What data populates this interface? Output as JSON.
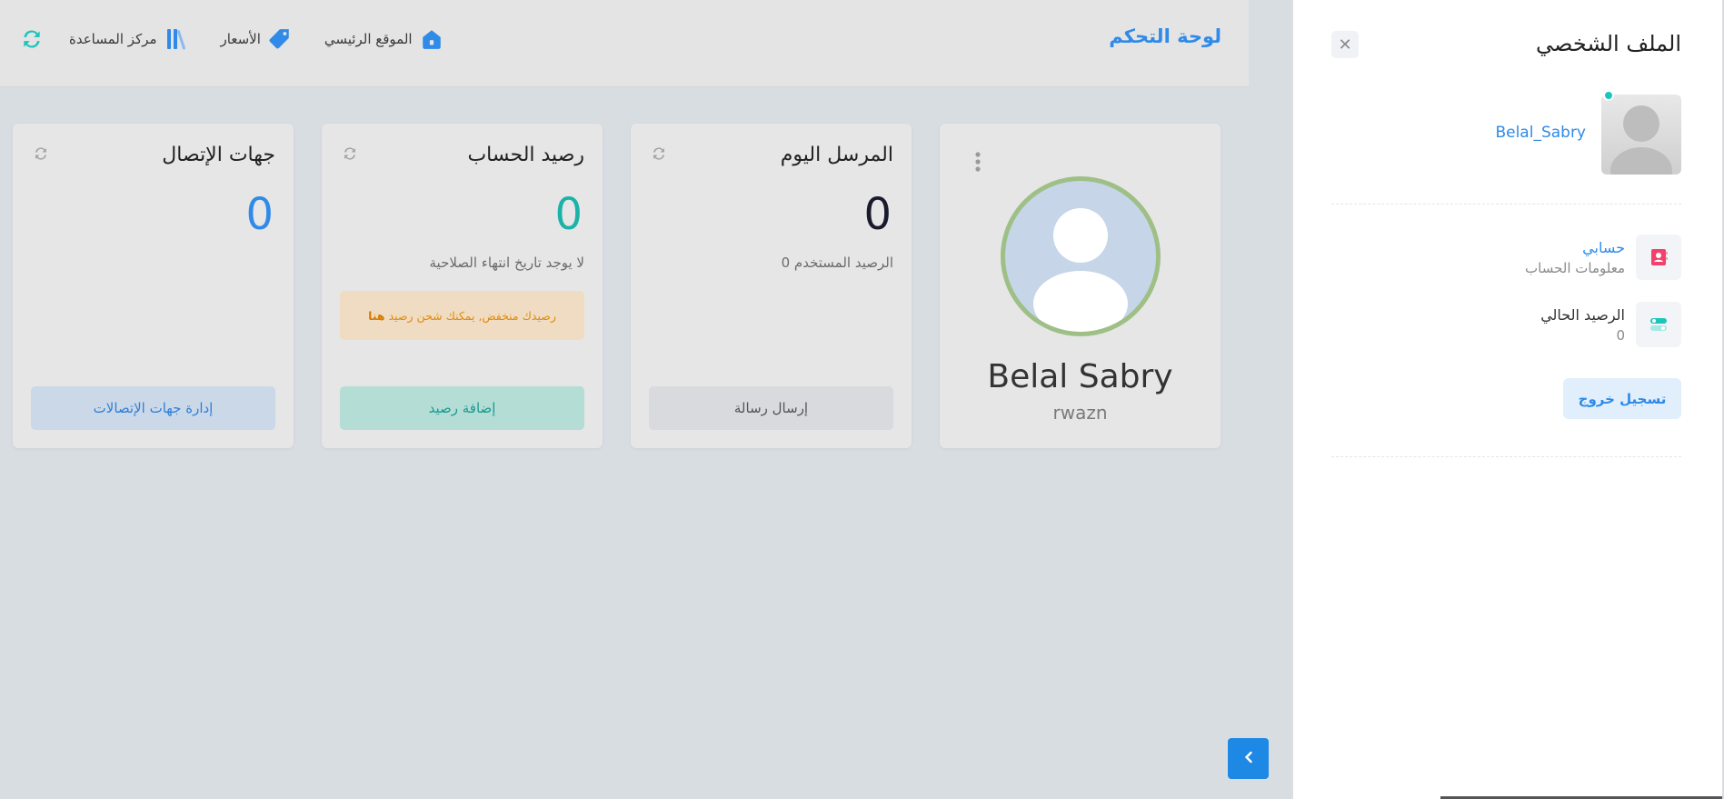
{
  "header": {
    "brand": "لوحة التحكم",
    "nav": [
      {
        "label": "الموقع الرئيسي",
        "icon": "home-icon"
      },
      {
        "label": "الأسعار",
        "icon": "price-tag-icon"
      },
      {
        "label": "مركز المساعدة",
        "icon": "library-books-icon"
      }
    ]
  },
  "profile_card": {
    "name": "Belal Sabry",
    "username": "rwazn"
  },
  "cards": {
    "sent_today": {
      "title": "المرسل اليوم",
      "value": "0",
      "sub": "الرصيد المستخدم 0",
      "button": "إرسال رسالة"
    },
    "balance": {
      "title": "رصيد الحساب",
      "value": "0",
      "sub": "لا يوجد تاريخ انتهاء الصلاحية",
      "warning": "رصيدك منخفض, يمكنك شحن رصيد",
      "warning_link": "هنا",
      "button": "إضافة رصيد"
    },
    "contacts": {
      "title": "جهات الإتصال",
      "value": "0",
      "button": "إدارة جهات الإتصالات"
    }
  },
  "panel": {
    "title": "الملف الشخصي",
    "username": "Belal_Sabry",
    "account_title": "حسابي",
    "account_sub": "معلومات الحساب",
    "balance_title": "الرصيد الحالي",
    "balance_value": "0",
    "logout": "تسجيل خروج"
  },
  "colors": {
    "accent": "#2f8ae8",
    "teal": "#1bc5bd",
    "dark_value": "#1a1a2e",
    "warning": "#e08c10"
  }
}
